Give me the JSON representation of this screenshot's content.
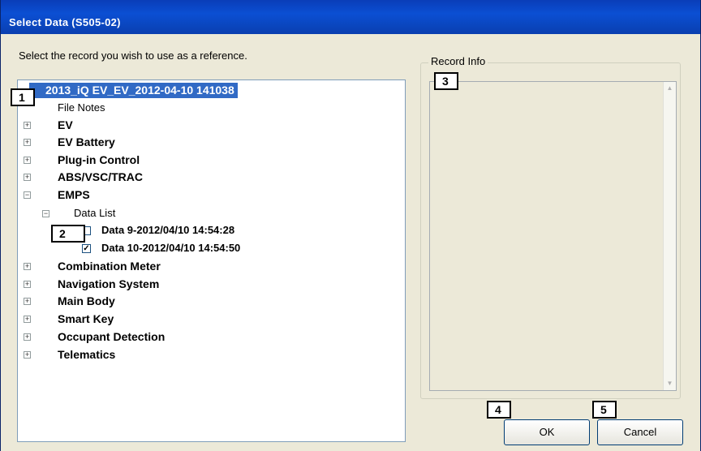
{
  "window": {
    "title": "Select Data (S505-02)"
  },
  "instruction": "Select the record you wish to use as a reference.",
  "tree": {
    "root": "2013_iQ EV_EV_2012-04-10 141038",
    "file_notes": "File Notes",
    "groups_before": [
      "EV",
      "EV Battery",
      "Plug-in Control",
      "ABS/VSC/TRAC"
    ],
    "expanded_group": "EMPS",
    "data_list_label": "Data List",
    "data_items": [
      {
        "label": "Data 9-2012/04/10 14:54:28",
        "checked": false
      },
      {
        "label": "Data 10-2012/04/10 14:54:50",
        "checked": true
      }
    ],
    "groups_after": [
      "Combination Meter",
      "Navigation System",
      "Main Body",
      "Smart Key",
      "Occupant Detection",
      "Telematics"
    ],
    "expander_collapsed": "+",
    "expander_expanded": "−",
    "check_mark": "✓"
  },
  "record_info": {
    "legend": "Record Info"
  },
  "callouts": [
    "1",
    "2",
    "3",
    "4",
    "5"
  ],
  "buttons": {
    "ok": "OK",
    "cancel": "Cancel"
  },
  "colors": {
    "titlebar": "#0b4fd3",
    "selection": "#316ac5",
    "dialog_bg": "#ece9d8"
  }
}
